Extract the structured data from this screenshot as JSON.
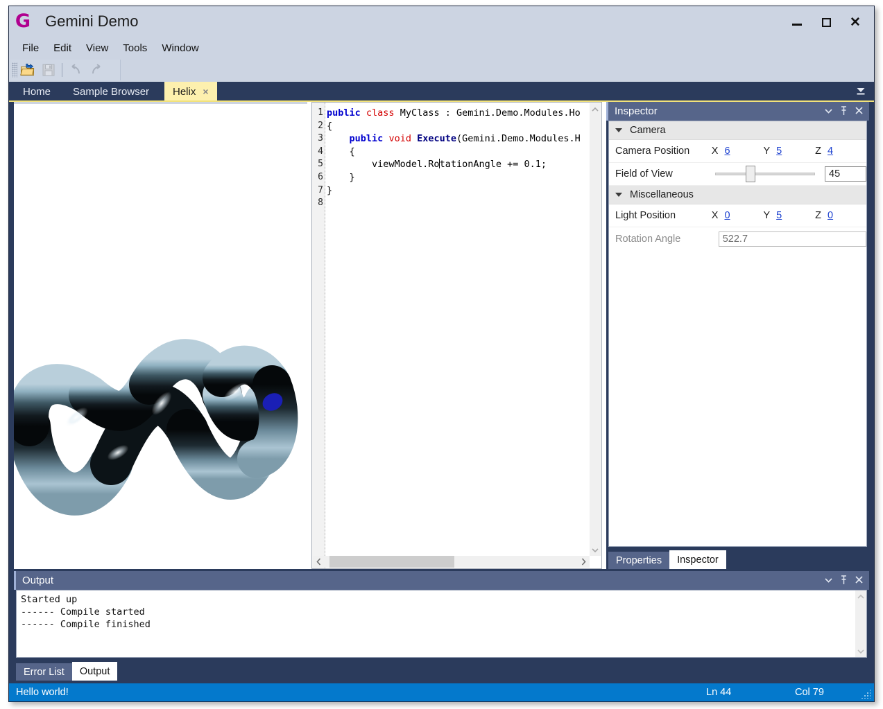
{
  "window": {
    "title": "Gemini Demo",
    "logo_glyph": "G",
    "controls": {
      "minimize": "minimize-icon",
      "maximize": "maximize-icon",
      "close": "close-icon"
    }
  },
  "menubar": {
    "items": [
      "File",
      "Edit",
      "View",
      "Tools",
      "Window"
    ]
  },
  "toolbar": {
    "buttons": [
      {
        "name": "open-file-button",
        "icon": "open-folder-icon",
        "enabled": true
      },
      {
        "name": "save-button",
        "icon": "save-disk-icon",
        "enabled": false
      },
      {
        "name": "undo-button",
        "icon": "undo-arrow-icon",
        "enabled": false
      },
      {
        "name": "redo-button",
        "icon": "redo-arrow-icon",
        "enabled": false
      }
    ]
  },
  "tabs": {
    "items": [
      {
        "label": "Home",
        "active": false,
        "closable": false
      },
      {
        "label": "Sample Browser",
        "active": false,
        "closable": false
      },
      {
        "label": "Helix",
        "active": true,
        "closable": true
      }
    ],
    "close_glyph": "×",
    "dropdown_icon": "tab-list-dropdown-icon"
  },
  "viewport": {
    "content": "3d-helix-render",
    "background": "#ffffff"
  },
  "editor": {
    "line_numbers": [
      "1",
      "2",
      "3",
      "4",
      "5",
      "6",
      "7",
      "8"
    ],
    "lines": [
      [
        {
          "t": "public",
          "c": "kw-blue"
        },
        {
          "t": " ",
          "c": ""
        },
        {
          "t": "class",
          "c": "kw-red"
        },
        {
          "t": " MyClass : Gemini.Demo.Modules.Ho",
          "c": ""
        }
      ],
      [
        {
          "t": "{",
          "c": ""
        }
      ],
      [
        {
          "t": "    ",
          "c": ""
        },
        {
          "t": "public",
          "c": "kw-blue"
        },
        {
          "t": " ",
          "c": ""
        },
        {
          "t": "void",
          "c": "kw-red"
        },
        {
          "t": " ",
          "c": ""
        },
        {
          "t": "Execute",
          "c": "kw-id"
        },
        {
          "t": "(Gemini.Demo.Modules.H",
          "c": ""
        }
      ],
      [
        {
          "t": "    {",
          "c": ""
        }
      ],
      [
        {
          "t": "        viewModel.Ro",
          "c": ""
        },
        {
          "t": "|CARET|",
          "c": "caret"
        },
        {
          "t": "tationAngle += 0.1;",
          "c": ""
        }
      ],
      [
        {
          "t": "    }",
          "c": ""
        }
      ],
      [
        {
          "t": "}",
          "c": ""
        }
      ],
      [
        {
          "t": "",
          "c": ""
        }
      ]
    ],
    "scroll": {
      "h_thumb_pct": 45,
      "up_arrow": "⌃",
      "down_arrow": "⌄",
      "left_arrow": "‹",
      "right_arrow": "›"
    }
  },
  "inspector": {
    "title": "Inspector",
    "header_icons": [
      {
        "name": "panel-dropdown-icon",
        "glyph": "▾"
      },
      {
        "name": "pin-icon",
        "glyph": "⚐"
      },
      {
        "name": "close-icon",
        "glyph": "×"
      }
    ],
    "groups": [
      {
        "name": "Camera",
        "rows": [
          {
            "type": "vector",
            "label": "Camera Position",
            "axes": [
              {
                "axis": "X",
                "value": "6"
              },
              {
                "axis": "Y",
                "value": "5"
              },
              {
                "axis": "Z",
                "value": "4"
              }
            ]
          },
          {
            "type": "slider",
            "label": "Field of View",
            "value": "45",
            "thumb_pct": 30
          }
        ]
      },
      {
        "name": "Miscellaneous",
        "rows": [
          {
            "type": "vector",
            "label": "Light Position",
            "axes": [
              {
                "axis": "X",
                "value": "0"
              },
              {
                "axis": "Y",
                "value": "5"
              },
              {
                "axis": "Z",
                "value": "0"
              }
            ]
          },
          {
            "type": "textbox",
            "label": "Rotation Angle",
            "value": "522.7",
            "readonly": true
          }
        ]
      }
    ],
    "tabs": [
      {
        "label": "Properties",
        "active": false
      },
      {
        "label": "Inspector",
        "active": true
      }
    ]
  },
  "output": {
    "title": "Output",
    "header_icons": [
      {
        "name": "panel-dropdown-icon",
        "glyph": "▾"
      },
      {
        "name": "pin-icon",
        "glyph": "⚐"
      },
      {
        "name": "close-icon",
        "glyph": "×"
      }
    ],
    "text": "Started up\n------ Compile started\n------ Compile finished",
    "tabs": [
      {
        "label": "Error List",
        "active": false
      },
      {
        "label": "Output",
        "active": true
      }
    ]
  },
  "statusbar": {
    "message": "Hello world!",
    "line": "Ln 44",
    "column": "Col 79",
    "accent": "#0479cc"
  }
}
